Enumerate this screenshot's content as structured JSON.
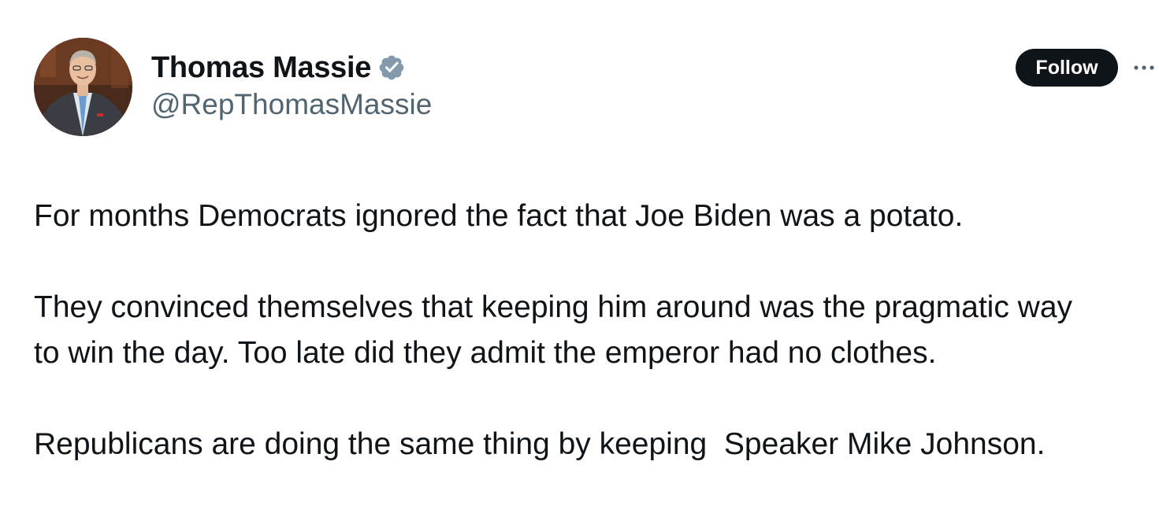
{
  "author": {
    "display_name": "Thomas Massie",
    "handle": "@RepThomasMassie",
    "verified": true
  },
  "actions": {
    "follow_label": "Follow",
    "more_icon": "more-horizontal-icon"
  },
  "tweet": {
    "paragraphs": [
      "For months Democrats ignored the fact that Joe Biden was a potato.",
      "They convinced themselves that keeping him around was the pragmatic way to win the day. Too late did they admit the emperor had no clothes.",
      "Republicans are doing the same thing by keeping  Speaker Mike Johnson."
    ]
  },
  "colors": {
    "text_primary": "#0f1419",
    "text_secondary": "#536471",
    "verified_badge": "#829aab",
    "button_bg": "#0f1419"
  }
}
